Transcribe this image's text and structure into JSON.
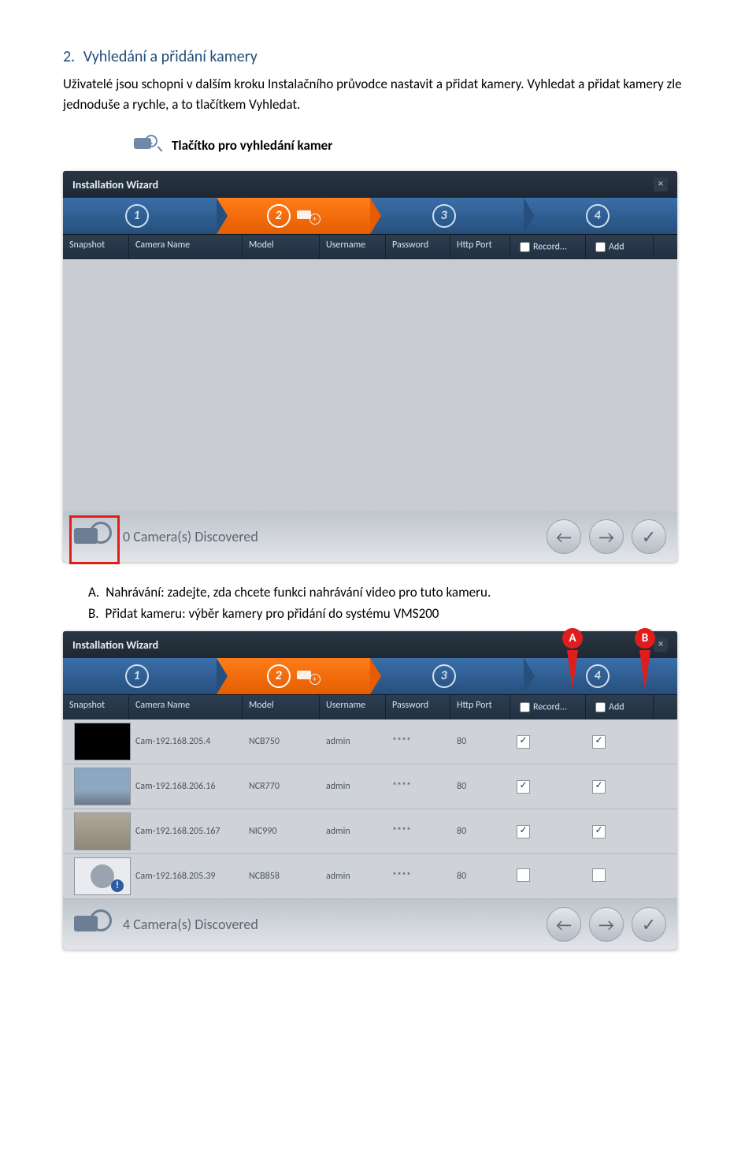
{
  "heading": {
    "number": "2.",
    "text": "Vyhledání a přidání kamery"
  },
  "paragraph": "Uživatelé jsou schopni v dalším kroku Instalačního průvodce nastavit a přidat kamery. Vyhledat a přidat kamery zle jednoduše a rychle, a to tlačítkem Vyhledat.",
  "searchButtonCaption": "Tlačítko pro vyhledání kamer",
  "wizardTitle": "Installation Wizard",
  "steps": [
    "1",
    "2",
    "3",
    "4"
  ],
  "columns": {
    "snapshot": "Snapshot",
    "cameraName": "Camera Name",
    "model": "Model",
    "username": "Username",
    "password": "Password",
    "httpPort": "Http Port",
    "record": "Record...",
    "add": "Add"
  },
  "footer1": "0  Camera(s) Discovered",
  "subA": {
    "letter": "A.",
    "text": "Nahrávání: zadejte, zda chcete funkci nahrávání video pro tuto kameru."
  },
  "subB": {
    "letter": "B.",
    "text": "Přidat kameru: výběr kamery pro přidání do systému VMS200"
  },
  "markers": {
    "a": "A",
    "b": "B"
  },
  "rows": [
    {
      "thumb": "thumb-black",
      "name": "Cam-192.168.205.4",
      "model": "NCB750",
      "user": "admin",
      "pass": "****",
      "port": "80",
      "rec": true,
      "add": true
    },
    {
      "thumb": "thumb-sky",
      "name": "Cam-192.168.206.16",
      "model": "NCR770",
      "user": "admin",
      "pass": "****",
      "port": "80",
      "rec": true,
      "add": true
    },
    {
      "thumb": "thumb-wall",
      "name": "Cam-192.168.205.167",
      "model": "NIC990",
      "user": "admin",
      "pass": "****",
      "port": "80",
      "rec": true,
      "add": true
    },
    {
      "thumb": "thumb-none",
      "name": "Cam-192.168.205.39",
      "model": "NCB858",
      "user": "admin",
      "pass": "****",
      "port": "80",
      "rec": false,
      "add": false
    }
  ],
  "footer2": "4 Camera(s) Discovered"
}
